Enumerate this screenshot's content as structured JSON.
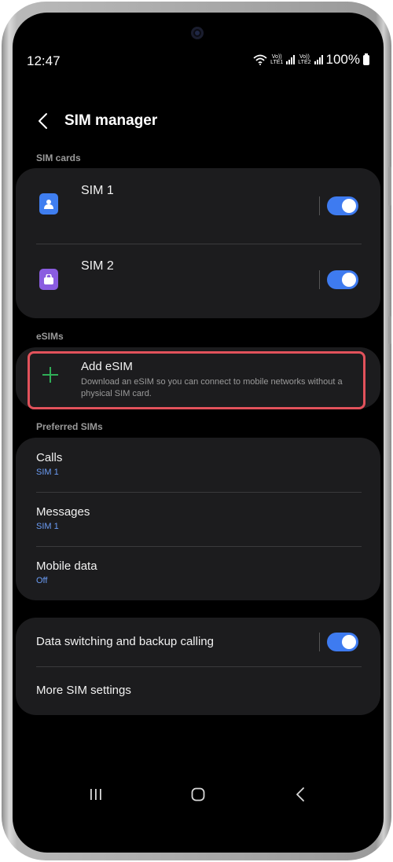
{
  "status_bar": {
    "time": "12:47",
    "sim1_label_top": "Vo))",
    "sim1_label_bottom": "LTE1",
    "sim2_label_top": "Vo))",
    "sim2_label_bottom": "LTE2",
    "battery": "100%",
    "icons": [
      "wifi-icon",
      "signal-icon",
      "battery-icon"
    ]
  },
  "header": {
    "title": "SIM manager",
    "back_icon": "chevron-left-icon"
  },
  "sim_cards": {
    "section_label": "SIM cards",
    "items": [
      {
        "name": "SIM 1",
        "icon": "sim-person-icon",
        "icon_color": "#3f7ef0",
        "enabled": true
      },
      {
        "name": "SIM 2",
        "icon": "sim-bag-icon",
        "icon_color": "#8a5ce0",
        "enabled": true
      }
    ]
  },
  "esims": {
    "section_label": "eSIMs",
    "add_title": "Add eSIM",
    "add_description": "Download an eSIM so you can connect to mobile networks without a physical SIM card.",
    "add_icon": "plus-icon",
    "highlight_color": "#e2525b"
  },
  "preferred_sims": {
    "section_label": "Preferred SIMs",
    "items": [
      {
        "title": "Calls",
        "value": "SIM 1"
      },
      {
        "title": "Messages",
        "value": "SIM 1"
      },
      {
        "title": "Mobile data",
        "value": "Off"
      }
    ]
  },
  "more": {
    "data_switching_label": "Data switching and backup calling",
    "data_switching_enabled": true,
    "more_settings_label": "More SIM settings"
  },
  "nav_bar": {
    "icons": [
      "recent-apps-icon",
      "home-icon",
      "back-icon"
    ]
  },
  "colors": {
    "accent": "#3e7bf0",
    "card_bg": "#1c1c1e",
    "value_blue": "#6b9cf5",
    "plus_green": "#2fae57"
  }
}
